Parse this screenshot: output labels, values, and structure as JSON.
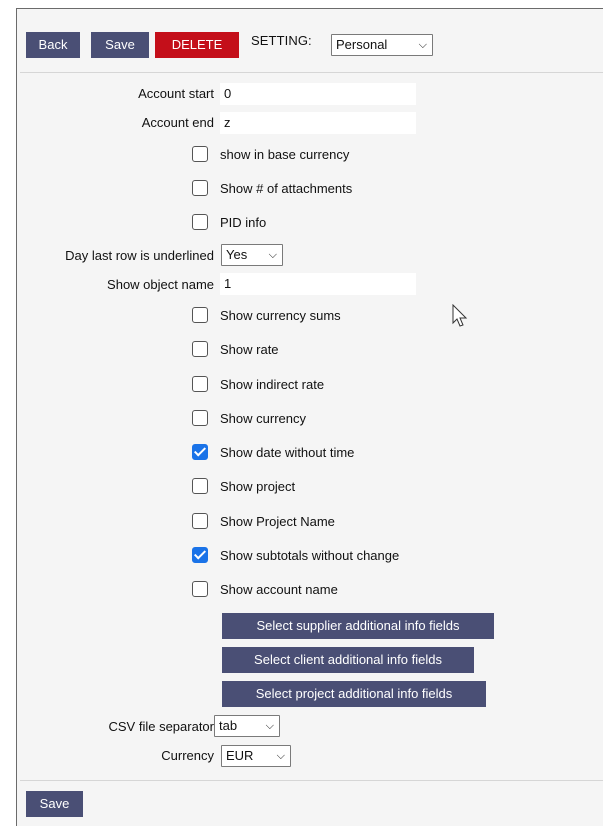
{
  "toolbar": {
    "back_label": "Back",
    "save_label": "Save",
    "delete_label": "DELETE",
    "setting_label": "SETTING:",
    "setting_value": "Personal"
  },
  "fields": {
    "account_start": {
      "label": "Account start",
      "value": "0"
    },
    "account_end": {
      "label": "Account end",
      "value": "z"
    },
    "day_last_row": {
      "label": "Day last row is underlined",
      "value": "Yes"
    },
    "show_object_name": {
      "label": "Show object name",
      "value": "1"
    },
    "csv_separator": {
      "label": "CSV file separator",
      "value": "tab"
    },
    "currency": {
      "label": "Currency",
      "value": "EUR"
    }
  },
  "checkboxes_a": [
    {
      "label": "show in base currency",
      "checked": false
    },
    {
      "label": "Show # of attachments",
      "checked": false
    },
    {
      "label": "PID info",
      "checked": false
    }
  ],
  "checkboxes_b": [
    {
      "label": "Show currency sums",
      "checked": false
    },
    {
      "label": "Show rate",
      "checked": false
    },
    {
      "label": "Show indirect rate",
      "checked": false
    },
    {
      "label": "Show currency",
      "checked": false
    },
    {
      "label": "Show date without time",
      "checked": true
    },
    {
      "label": "Show project",
      "checked": false
    },
    {
      "label": "Show Project Name",
      "checked": false
    },
    {
      "label": "Show subtotals without change",
      "checked": true
    },
    {
      "label": "Show account name",
      "checked": false
    }
  ],
  "info_buttons": {
    "supplier": "Select supplier additional info fields",
    "client": "Select client additional info fields",
    "project": "Select project additional info fields"
  },
  "footer": {
    "save_label": "Save"
  },
  "colors": {
    "button_bg": "#4a4f75",
    "delete_bg": "#c40f1a",
    "checkbox_on": "#1a73e8",
    "panel_bg": "#f5f5f5"
  },
  "icons": {
    "chevron": "chevron-down-icon",
    "check": "check-icon",
    "cursor": "mouse-pointer-icon"
  }
}
